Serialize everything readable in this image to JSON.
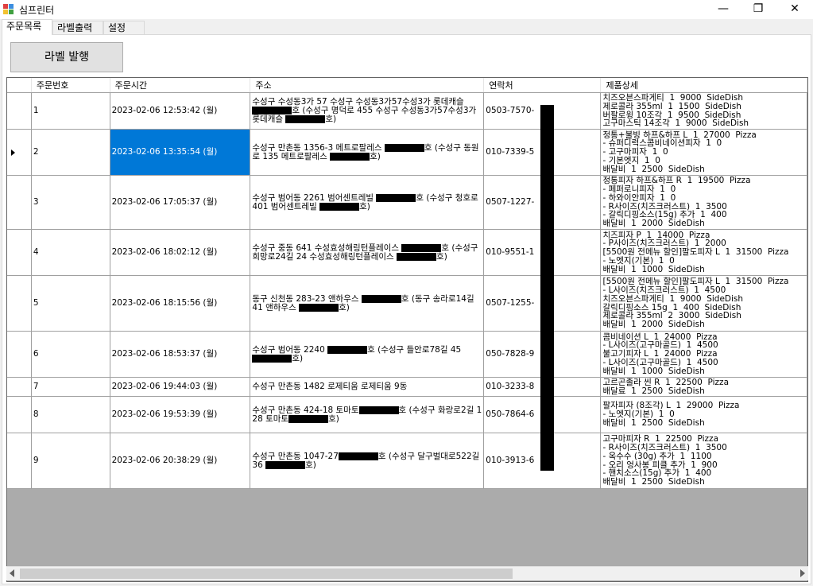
{
  "window": {
    "title": "심프린터",
    "minimize": "—",
    "maximize": "❐",
    "close": "✕"
  },
  "tabs": [
    "주문목록",
    "라벨출력",
    "설정"
  ],
  "toolbar": {
    "print_label": "라벨 발행"
  },
  "table": {
    "columns": [
      "주문번호",
      "주문시간",
      "주소",
      "연락처",
      "제품상세"
    ],
    "rows": [
      {
        "no": "1",
        "time": "2023-02-06 12:53:42 (월)",
        "addr": [
          "수성구 수성동3가 57 수성구 수성동3가57수성3가 롯데캐슬 ",
          "[R]",
          "호 (수성구 명덕로 455 수성구 수성동3가57수성3가 롯데캐슬 ",
          "[R]",
          "호)"
        ],
        "phone": "0503-7570-",
        "detail": "치즈오븐스파게티  1  9000  SideDish\n제로콜라 355ml  1  1500  SideDish\n버팔로윙 10조각  1  9500  SideDish\n고구마스틱 14조각  1  9000  SideDish"
      },
      {
        "no": "2",
        "time": "2023-02-06 13:35:54 (월)",
        "addr": [
          "수성구 만촌동 1356-3 메트로팔레스 ",
          "[R]",
          "호 (수성구 동원로 135 메트로팔레스 ",
          "[R]",
          "호)"
        ],
        "phone": "010-7339-5",
        "detail": "정통+불빙 하프&하프 L  1  27000  Pizza\n- 슈퍼디럭스콤비네이션피자  1  0\n- 고구마피자  1  0\n- 기본엣지  1  0\n배달비  1  2500  SideDish"
      },
      {
        "no": "3",
        "time": "2023-02-06 17:05:37 (월)",
        "addr": [
          "수성구 범어동 2261 범어센트레빌 ",
          "[R]",
          "호 (수성구 청호로 401 범어센트레빌 ",
          "[R]",
          "호)"
        ],
        "phone": "0507-1227-",
        "detail": "정통피자 하프&하프 R  1  19500  Pizza\n- 페퍼로니피자  1  0\n- 하와이안피자  1  0\n- R사이즈(치즈크러스트)  1  3500\n- 갈릭디핑소스(15g) 추가  1  400\n배달비  1  2000  SideDish"
      },
      {
        "no": "4",
        "time": "2023-02-06 18:02:12 (월)",
        "addr": [
          "수성구 중동 641 수성효성해링턴플레이스 ",
          "[R]",
          "호 (수성구 희망로24길 24 수성효성해링턴플레이스 ",
          "[R]",
          "호)"
        ],
        "phone": "010-9551-1",
        "detail": "치즈피자 P  1  14000  Pizza\n- P사이즈(치즈크러스트)  1  2000\n[5500원 전메뉴 할인]팔도피자 L  1  31500  Pizza\n- 노엣지(기본)  1  0\n배달비  1  1000  SideDish"
      },
      {
        "no": "5",
        "time": "2023-02-06 18:15:56 (월)",
        "addr": [
          "동구 신천동 283-23 앤하우스 ",
          "[R]",
          "호 (동구 송라로14길 41 앤하우스 ",
          "[R]",
          "호)"
        ],
        "phone": "0507-1255-",
        "detail": "[5500원 전메뉴 할인]팔도피자 L  1  31500  Pizza\n- L사이즈(치즈크러스트)  1  4500\n치즈오븐스파게티  1  9000  SideDish\n갈릭디핑소스 15g  1  400  SideDish\n제로콜라 355ml  2  3000  SideDish\n배달비  1  2000  SideDish"
      },
      {
        "no": "6",
        "time": "2023-02-06 18:53:37 (월)",
        "addr": [
          "수성구 범어동 2240 ",
          "[R]",
          "호 (수성구 들안로78길 45 ",
          "[R]",
          "호)"
        ],
        "phone": "050-7828-9",
        "detail": "콤비네이션 L  1  24000  Pizza\n- L사이즈(고구마골드)  1  4500\n불고기피자 L  1  24000  Pizza\n- L사이즈(고구마골드)  1  4500\n배달비  1  1000  SideDish"
      },
      {
        "no": "7",
        "time": "2023-02-06 19:44:03 (월)",
        "addr": [
          "수성구 만촌동 1482 로제티움 로제티움 9동"
        ],
        "phone": "010-3233-8",
        "detail": "고르곤졸라 씬 R  1  22500  Pizza\n배달료  1  2500  SideDish"
      },
      {
        "no": "8",
        "time": "2023-02-06 19:53:39 (월)",
        "addr": [
          "수성구 만촌동 424-18 토마토",
          "[R]",
          "호 (수성구 화랑로2길 128 토마토",
          "[R]",
          "호)"
        ],
        "phone": "050-7864-6",
        "detail": "팔자피자 (8조각) L  1  29000  Pizza\n- 노엣지(기본)  1  0\n배달비  1  2500  SideDish"
      },
      {
        "no": "9",
        "time": "2023-02-06 20:38:29 (월)",
        "addr": [
          "수성구 만촌동 1047-27",
          "[R]",
          "호 (수성구 달구벌대로522길 36 ",
          "[R]",
          "호)"
        ],
        "phone": "010-3913-6",
        "detail": "고구마피자 R  1  22500  Pizza\n- R사이즈(치즈크러스트)  1  3500\n- 옥수수 (30g) 추가  1  1100\n- 오리 엉사봉 피클 추가  1  900\n- 핸치소스(15g) 추가  1  400\n배달비  1  2500  SideDish"
      }
    ]
  }
}
